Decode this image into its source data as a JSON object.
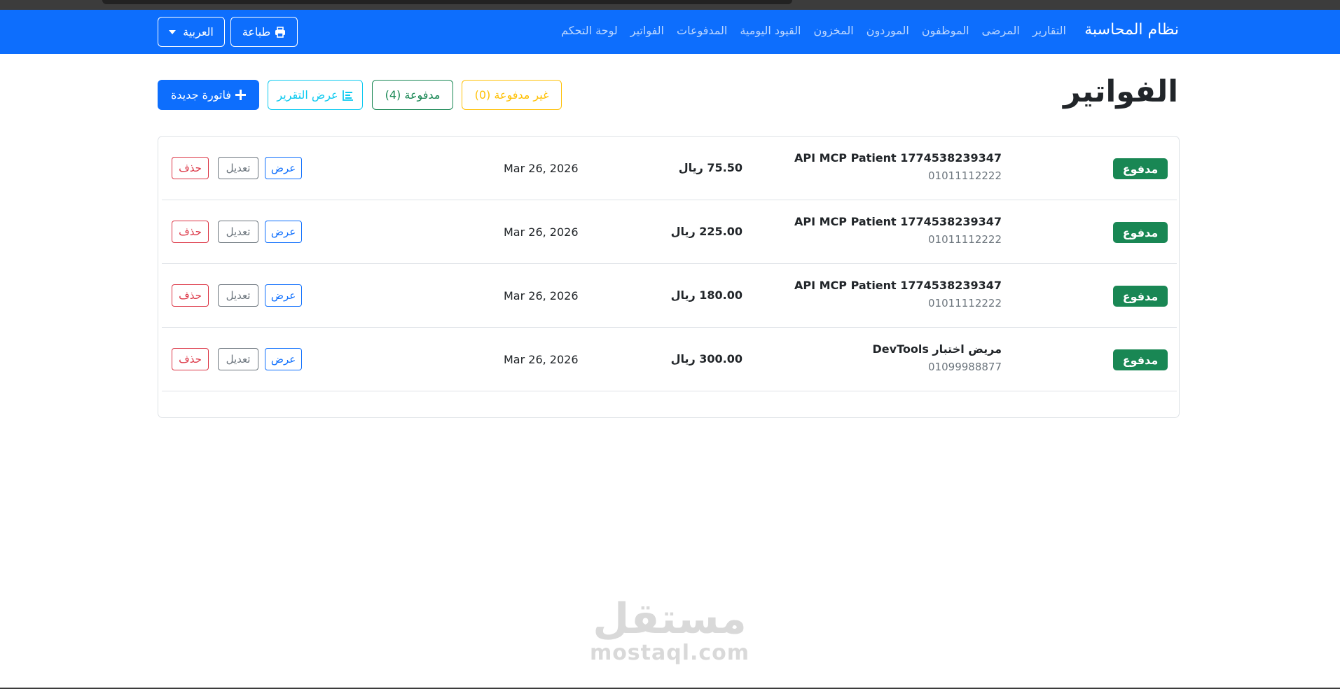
{
  "navbar": {
    "brand": "نظام المحاسبة",
    "links": [
      "لوحة التحكم",
      "الفواتير",
      "المدفوعات",
      "القيود اليومية",
      "المخزون",
      "الموردون",
      "الموظفون",
      "المرضى",
      "التقارير"
    ],
    "print_label": "طباعة",
    "language_label": "العربية",
    "bg_color": "#0d6efd"
  },
  "header": {
    "title": "الفواتير",
    "unpaid_label": "غير مدفوعة (0)",
    "paid_label": "مدفوعة (4)",
    "report_label": "عرض التقرير",
    "new_invoice_label": "فاتورة جديدة"
  },
  "invoices": [
    {
      "status": "مدفوع",
      "patient_name": "API MCP Patient 1774538239347",
      "phone": "01011112222",
      "amount": "75.50 ريال",
      "date": "Mar 26, 2026",
      "view_label": "عرض",
      "edit_label": "تعديل",
      "delete_label": "حذف"
    },
    {
      "status": "مدفوع",
      "patient_name": "API MCP Patient 1774538239347",
      "phone": "01011112222",
      "amount": "225.00 ريال",
      "date": "Mar 26, 2026",
      "view_label": "عرض",
      "edit_label": "تعديل",
      "delete_label": "حذف"
    },
    {
      "status": "مدفوع",
      "patient_name": "API MCP Patient 1774538239347",
      "phone": "01011112222",
      "amount": "180.00 ريال",
      "date": "Mar 26, 2026",
      "view_label": "عرض",
      "edit_label": "تعديل",
      "delete_label": "حذف"
    },
    {
      "status": "مدفوع",
      "patient_name": "مريض اختبار DevTools",
      "phone": "01099988877",
      "amount": "300.00 ريال",
      "date": "Mar 26, 2026",
      "view_label": "عرض",
      "edit_label": "تعديل",
      "delete_label": "حذف"
    }
  ],
  "watermark": {
    "arabic": "مستقل",
    "latin": "mostaql.com"
  },
  "icons": {
    "print": "printer-icon",
    "report": "bar-chart-icon",
    "new": "plus-icon",
    "language": "caret-down-icon"
  }
}
